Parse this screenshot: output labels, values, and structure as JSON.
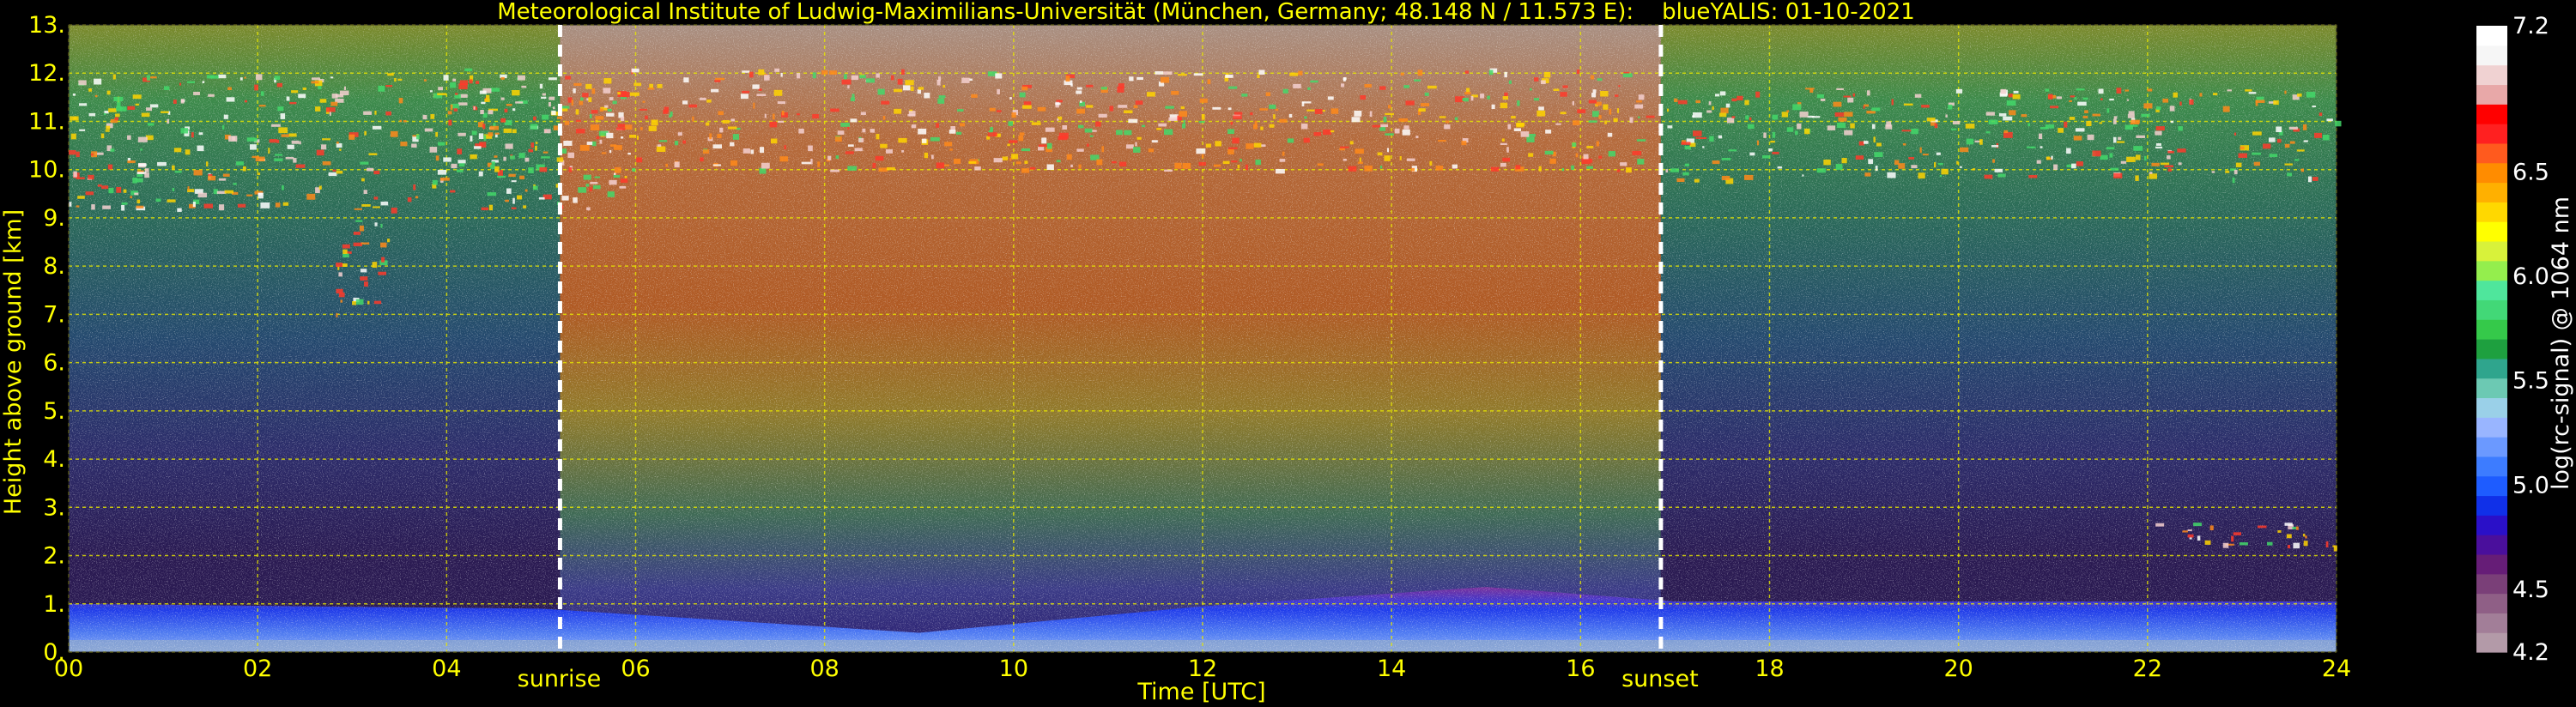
{
  "chart_data": {
    "type": "heatmap",
    "title": "Meteorological Institute of Ludwig-Maximilians-Universität (München, Germany; 48.148 N / 11.573 E):    blueYALIS: 01-10-2021",
    "xlabel": "Time [UTC]",
    "ylabel": "Height above ground [km]",
    "xlim": [
      0,
      24
    ],
    "ylim": [
      0,
      13
    ],
    "x_ticks": [
      "00",
      "02",
      "04",
      "06",
      "08",
      "10",
      "12",
      "14",
      "16",
      "18",
      "20",
      "22",
      "24"
    ],
    "y_ticks": [
      "0.",
      "1.",
      "2.",
      "3.",
      "4.",
      "5.",
      "6.",
      "7.",
      "8.",
      "9.",
      "10.",
      "11.",
      "12.",
      "13."
    ],
    "grid": true,
    "annotations": [
      {
        "text": "sunrise",
        "x": 5.2
      },
      {
        "text": "sunset",
        "x": 16.85
      }
    ],
    "colorbar": {
      "label": "log(rc-signal) @ 1064 nm",
      "ticks": [
        "4.2",
        "4.5",
        "5.0",
        "5.5",
        "6.0",
        "6.5",
        "7.2"
      ],
      "range": [
        4.2,
        7.2
      ],
      "colors": [
        "#b39aa8",
        "#a27e98",
        "#8f5f86",
        "#7a3f78",
        "#661d77",
        "#4a0f9c",
        "#2a10c8",
        "#1030e8",
        "#1e5cff",
        "#3d7cff",
        "#6b99ff",
        "#99b5ff",
        "#9ad0e8",
        "#6cc9b3",
        "#2fa58d",
        "#1ea03f",
        "#35c94a",
        "#42d877",
        "#4fe69c",
        "#94ee4d",
        "#d8f23a",
        "#ffff00",
        "#ffd800",
        "#ffb000",
        "#ff8c00",
        "#ff5a1e",
        "#ff2020",
        "#ff0000",
        "#e8a8a8",
        "#f0d2d2",
        "#f6f6f6",
        "#ffffff"
      ]
    },
    "cloud_layers": [
      {
        "description": "cirrus",
        "x": [
          0,
          6
        ],
        "y": [
          9.2,
          12.0
        ]
      },
      {
        "description": "cirrus",
        "x": [
          2.8,
          3.4
        ],
        "y": [
          6.9,
          9.3
        ]
      },
      {
        "description": "cirrus",
        "x": [
          4.0,
          16.7
        ],
        "y": [
          10.0,
          12.1
        ]
      },
      {
        "description": "cirrus",
        "x": [
          16.9,
          24
        ],
        "y": [
          9.8,
          11.7
        ]
      },
      {
        "description": "aerosol layer",
        "x": [
          22.0,
          24
        ],
        "y": [
          2.2,
          2.7
        ]
      }
    ],
    "boundary_layer_top_km": [
      {
        "x": 0,
        "y": 1.0
      },
      {
        "x": 5,
        "y": 0.9
      },
      {
        "x": 9,
        "y": 0.4
      },
      {
        "x": 12,
        "y": 0.95
      },
      {
        "x": 15,
        "y": 1.35
      },
      {
        "x": 17,
        "y": 1.05
      },
      {
        "x": 24,
        "y": 1.05
      }
    ]
  }
}
